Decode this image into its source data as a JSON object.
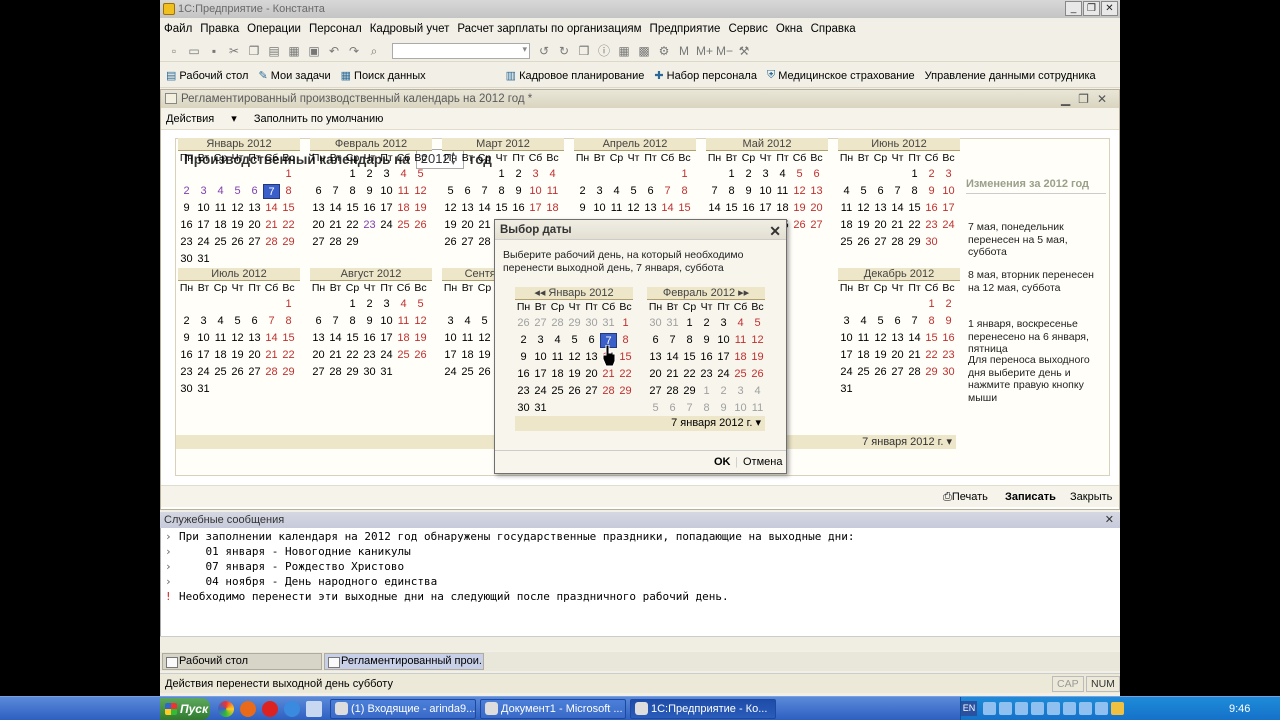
{
  "window": {
    "title": "1С:Предприятие - Константа"
  },
  "menu": [
    "Файл",
    "Правка",
    "Операции",
    "Персонал",
    "Кадровый учет",
    "Расчет зарплаты по организациям",
    "Предприятие",
    "Сервис",
    "Окна",
    "Справка"
  ],
  "quick": [
    "Рабочий стол",
    "Мои задачи",
    "Поиск данных",
    "Кадровое планирование",
    "Набор персонала",
    "Медицинское страхование",
    "Управление данными сотрудника"
  ],
  "doc": {
    "title": "Регламентированный производственный календарь на 2012 год *",
    "actions": "Действия",
    "fill_default": "Заполнить по умолчанию",
    "header_label": "Производственный календарь на",
    "year": "2012",
    "header_suffix": "год",
    "date_footer": "7 января 2012 г.",
    "print": "Печать",
    "save": "Записать",
    "close": "Закрыть"
  },
  "weekdays": [
    "Пн",
    "Вт",
    "Ср",
    "Чт",
    "Пт",
    "Сб",
    "Вс"
  ],
  "months": [
    "Январь 2012",
    "Февраль 2012",
    "Март 2012",
    "Апрель 2012",
    "Май 2012",
    "Июнь 2012",
    "Июль 2012",
    "Август 2012",
    "Сентябрь 2012",
    "Декабрь 2012"
  ],
  "changes": {
    "title": "Изменения за 2012 год",
    "items": [
      "7 мая, понедельник перенесен на 5 мая, суббота",
      "8 мая, вторник перенесен на 12 мая, суббота",
      "1 января, воскресенье перенесено на 6 января, пятница",
      "Для переноса выходного дня выберите день и нажмите правую кнопку мыши"
    ]
  },
  "dialog": {
    "title": "Выбор даты",
    "text": "Выберите рабочий день, на который необходимо перенести выходной день, 7 января, суббота",
    "month1": "Январь 2012",
    "month2": "Февраль 2012",
    "date": "7 января 2012 г.",
    "ok": "OK",
    "cancel": "Отмена"
  },
  "service": {
    "title": "Служебные сообщения",
    "lines": [
      "При заполнении календаря на 2012 год обнаружены государственные праздники, попадающие на выходные дни:",
      "    01 января - Новогодние каникулы",
      "    07 января - Рождество Христово",
      "    04 ноября - День народного единства",
      "Необходимо перенести эти выходные дни на следующий после праздничного рабочий день."
    ]
  },
  "tabs": [
    "Рабочий стол",
    "Регламентированный прои..."
  ],
  "status": {
    "text": "Действия перенести выходной день субботу",
    "cap": "CAP",
    "num": "NUM"
  },
  "taskbar": {
    "start": "Пуск",
    "tasks": [
      "(1) Входящие - arinda9...",
      "Документ1 - Microsoft ...",
      "1С:Предприятие - Ко..."
    ],
    "lang": "EN",
    "clock": "9:46"
  }
}
